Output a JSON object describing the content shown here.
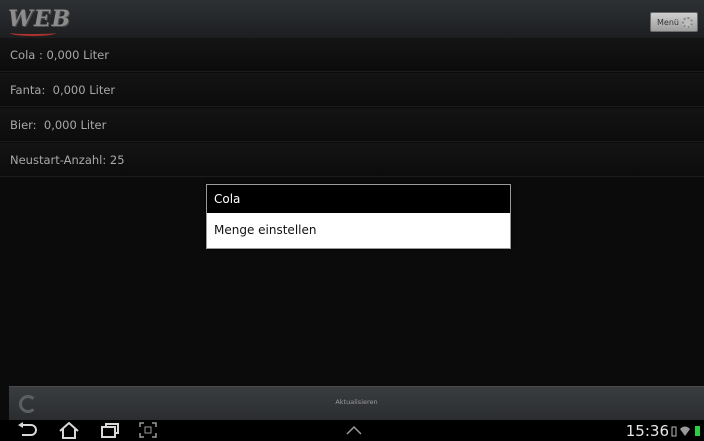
{
  "header": {
    "logo": "WEB",
    "menu_label": "Menü"
  },
  "rows": [
    {
      "label": "Cola : 0,000 Liter"
    },
    {
      "label": "Fanta:  0,000 Liter"
    },
    {
      "label": "Bier:  0,000 Liter"
    },
    {
      "label": "Neustart-Anzahl: 25"
    }
  ],
  "dialog": {
    "title": "Cola",
    "item": "Menge einstellen"
  },
  "bottom": {
    "refresh_label": "Aktualisieren"
  },
  "system": {
    "time": "15:36",
    "icons": [
      "back-icon",
      "home-icon",
      "recent-apps-icon",
      "screenshot-icon",
      "up-chevron-icon",
      "wifi-icon",
      "battery-icon"
    ],
    "battery_color": "#2ecc40"
  }
}
